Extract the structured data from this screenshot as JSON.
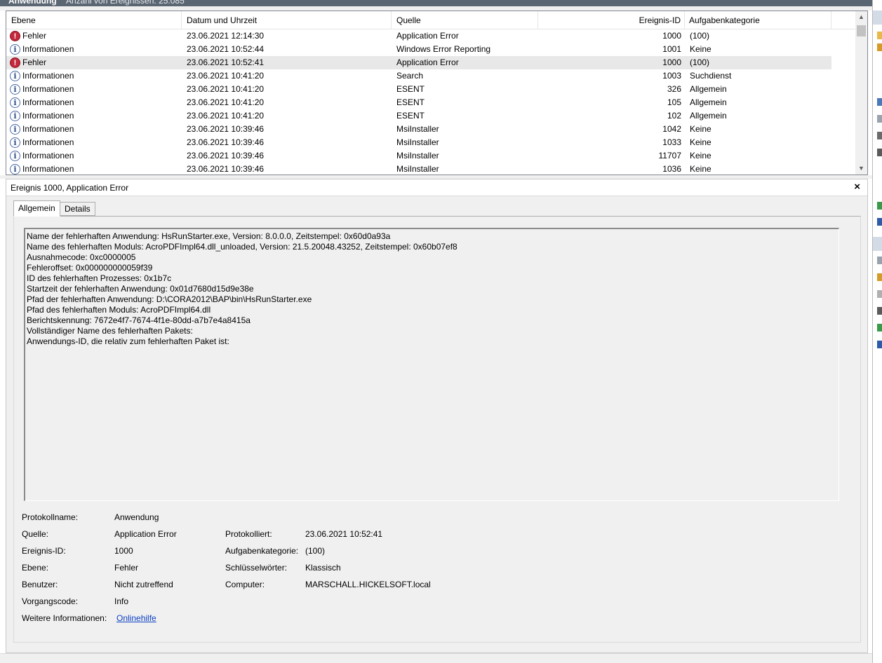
{
  "top_header": {
    "title": "Anwendung",
    "count_text": "Anzahl von Ereignissen: 25.085"
  },
  "list": {
    "columns": [
      "Ebene",
      "Datum und Uhrzeit",
      "Quelle",
      "Ereignis-ID",
      "Aufgabenkategorie"
    ],
    "rows": [
      {
        "level": "Fehler",
        "type": "error",
        "date": "23.06.2021 12:14:30",
        "source": "Application Error",
        "id": "1000",
        "category": "(100)"
      },
      {
        "level": "Informationen",
        "type": "info",
        "date": "23.06.2021 10:52:44",
        "source": "Windows Error Reporting",
        "id": "1001",
        "category": "Keine"
      },
      {
        "level": "Fehler",
        "type": "error",
        "date": "23.06.2021 10:52:41",
        "source": "Application Error",
        "id": "1000",
        "category": "(100)",
        "selected": true
      },
      {
        "level": "Informationen",
        "type": "info",
        "date": "23.06.2021 10:41:20",
        "source": "Search",
        "id": "1003",
        "category": "Suchdienst"
      },
      {
        "level": "Informationen",
        "type": "info",
        "date": "23.06.2021 10:41:20",
        "source": "ESENT",
        "id": "326",
        "category": "Allgemein"
      },
      {
        "level": "Informationen",
        "type": "info",
        "date": "23.06.2021 10:41:20",
        "source": "ESENT",
        "id": "105",
        "category": "Allgemein"
      },
      {
        "level": "Informationen",
        "type": "info",
        "date": "23.06.2021 10:41:20",
        "source": "ESENT",
        "id": "102",
        "category": "Allgemein"
      },
      {
        "level": "Informationen",
        "type": "info",
        "date": "23.06.2021 10:39:46",
        "source": "MsiInstaller",
        "id": "1042",
        "category": "Keine"
      },
      {
        "level": "Informationen",
        "type": "info",
        "date": "23.06.2021 10:39:46",
        "source": "MsiInstaller",
        "id": "1033",
        "category": "Keine"
      },
      {
        "level": "Informationen",
        "type": "info",
        "date": "23.06.2021 10:39:46",
        "source": "MsiInstaller",
        "id": "11707",
        "category": "Keine"
      },
      {
        "level": "Informationen",
        "type": "info",
        "date": "23.06.2021 10:39:46",
        "source": "MsiInstaller",
        "id": "1036",
        "category": "Keine"
      }
    ]
  },
  "detail": {
    "title": "Ereignis 1000, Application Error",
    "close_glyph": "×",
    "tabs": [
      "Allgemein",
      "Details"
    ],
    "description_lines": [
      "Name der fehlerhaften Anwendung: HsRunStarter.exe, Version: 8.0.0.0, Zeitstempel: 0x60d0a93a",
      "Name des fehlerhaften Moduls: AcroPDFImpl64.dll_unloaded, Version: 21.5.20048.43252, Zeitstempel: 0x60b07ef8",
      "Ausnahmecode: 0xc0000005",
      "Fehleroffset: 0x000000000059f39",
      "ID des fehlerhaften Prozesses: 0x1b7c",
      "Startzeit der fehlerhaften Anwendung: 0x01d7680d15d9e38e",
      "Pfad der fehlerhaften Anwendung: D:\\CORA2012\\BAP\\bin\\HsRunStarter.exe",
      "Pfad des fehlerhaften Moduls: AcroPDFImpl64.dll",
      "Berichtskennung: 7672e4f7-7674-4f1e-80dd-a7b7e4a8415a",
      "Vollständiger Name des fehlerhaften Pakets:",
      "Anwendungs-ID, die relativ zum fehlerhaften Paket ist:"
    ],
    "props": {
      "protokollname_label": "Protokollname:",
      "protokollname": "Anwendung",
      "quelle_label": "Quelle:",
      "quelle": "Application Error",
      "protokolliert_label": "Protokolliert:",
      "protokolliert": "23.06.2021 10:52:41",
      "ereignis_id_label": "Ereignis-ID:",
      "ereignis_id": "1000",
      "aufgabenkategorie_label": "Aufgabenkategorie:",
      "aufgabenkategorie": "(100)",
      "ebene_label": "Ebene:",
      "ebene": "Fehler",
      "schluesselwoerter_label": "Schlüsselwörter:",
      "schluesselwoerter": "Klassisch",
      "benutzer_label": "Benutzer:",
      "benutzer": "Nicht zutreffend",
      "computer_label": "Computer:",
      "computer": "MARSCHALL.HICKELSOFT.local",
      "vorgangscode_label": "Vorgangscode:",
      "vorgangscode": "Info",
      "weitere_label": "Weitere Informationen:",
      "weitere_link": "Onlinehilfe"
    }
  },
  "colors": {
    "error": "#c4293d",
    "info": "#2d4a86",
    "selection": "#e8e8e8",
    "link": "#0b3fc1"
  }
}
